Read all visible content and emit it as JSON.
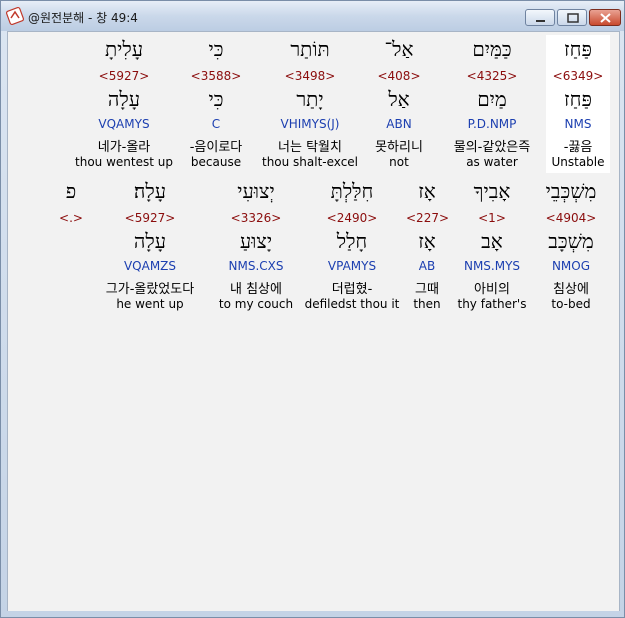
{
  "window": {
    "title": "@원전분해 - 창 49:4"
  },
  "rows": [
    {
      "cells": [
        {
          "heb1": "פַּחַז",
          "num": "<6349>",
          "heb2": "פַּחַז",
          "pars": "NMS",
          "kor": "-끓음",
          "eng": "Unstable",
          "highlight": true
        },
        {
          "heb1": "כַּמַּיִם",
          "num": "<4325>",
          "heb2": "מַיִם",
          "pars": "P.D.NMP",
          "kor": "물의-같았은즉",
          "eng": "as water"
        },
        {
          "heb1": "אַל־",
          "num": "<408>",
          "heb2": "אַל",
          "pars": "ABN",
          "kor": "못하리니",
          "eng": "not"
        },
        {
          "heb1": "תּוֹתַר",
          "num": "<3498>",
          "heb2": "יָתַר",
          "pars": "VHIMYS(J)",
          "kor": "너는 탁월치",
          "eng": "thou shalt-excel"
        },
        {
          "heb1": "כִּי",
          "num": "<3588>",
          "heb2": "כִּי",
          "pars": "C",
          "kor": "-음이로다",
          "eng": "because"
        },
        {
          "heb1": "עָלִיתָ",
          "num": "<5927>",
          "heb2": "עָלָה",
          "pars": "VQAMYS",
          "kor": "네가-올라",
          "eng": "thou wentest up"
        }
      ]
    },
    {
      "cells": [
        {
          "heb1": "מִשְׁכְּבֵי",
          "num": "<4904>",
          "heb2": "מִשְׁכָּב",
          "pars": "NMOG",
          "kor": "침상에",
          "eng": "to-bed"
        },
        {
          "heb1": "אָבִיךָ",
          "num": "<1>",
          "heb2": "אָב",
          "pars": "NMS.MYS",
          "kor": "아비의",
          "eng": "thy father's"
        },
        {
          "heb1": "אָז",
          "num": "<227>",
          "heb2": "אָז",
          "pars": "AB",
          "kor": "그때",
          "eng": "then"
        },
        {
          "heb1": "חִלַּלְתָּ",
          "num": "<2490>",
          "heb2": "חָלַל",
          "pars": "VPAMYS",
          "kor": "더럽혔-",
          "eng": "defiledst thou it"
        },
        {
          "heb1": "יְצוּעִי",
          "num": "<3326>",
          "heb2": "יָצוּעַ",
          "pars": "NMS.CXS",
          "kor": "내 침상에",
          "eng": "to my couch"
        },
        {
          "heb1": "עָלָה׃",
          "num": "<5927>",
          "heb2": "עָלָה",
          "pars": "VQAMZS",
          "kor": "그가-올랐었도다",
          "eng": "he went up"
        },
        {
          "heb1": "פ",
          "num": "<.>",
          "heb2": "",
          "pars": "",
          "kor": "",
          "eng": ""
        }
      ]
    }
  ]
}
